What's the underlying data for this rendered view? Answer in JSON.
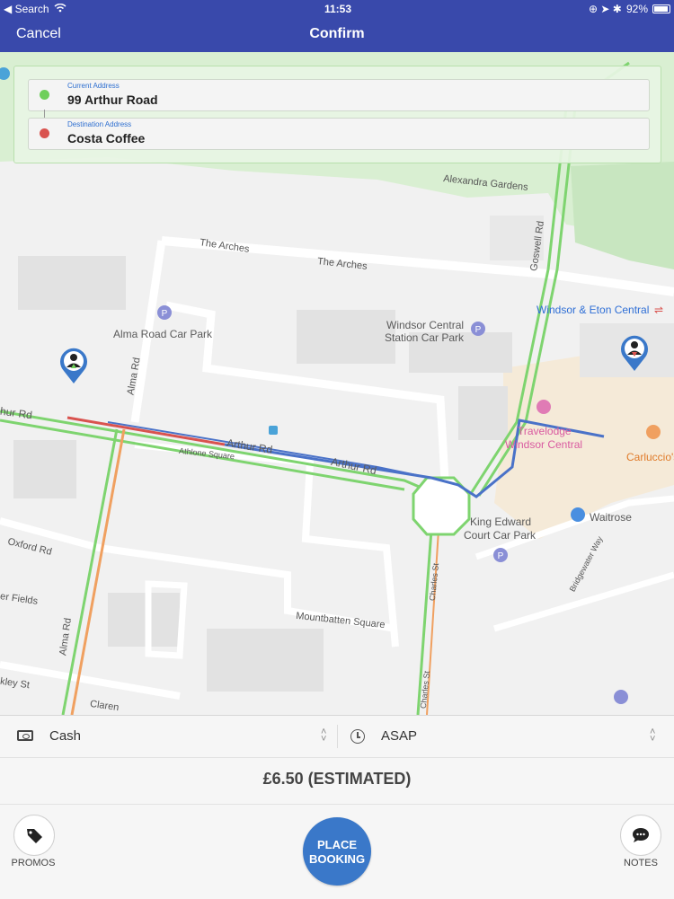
{
  "status_bar": {
    "back_label": "Search",
    "time": "11:53",
    "battery": "92%"
  },
  "nav": {
    "cancel_label": "Cancel",
    "title": "Confirm"
  },
  "addresses": {
    "current_label": "Current Address",
    "current_value": "99 Arthur Road",
    "destination_label": "Destination Address",
    "destination_value": "Costa Coffee"
  },
  "map": {
    "labels": {
      "alexandra_gardens": "Alexandra Gardens",
      "the_arches_1": "The Arches",
      "the_arches_2": "The Arches",
      "goswell_rd": "Goswell Rd",
      "windsor_eton": "Windsor & Eton Central",
      "alma_road_car_park": "Alma Road Car Park",
      "alma_rd_1": "Alma Rd",
      "alma_rd_2": "Alma Rd",
      "windsor_central_car_park_1": "Windsor Central",
      "windsor_central_car_park_2": "Station Car Park",
      "arthur_rd_left": "hur Rd",
      "arthur_rd_1": "Arthur Rd",
      "arthur_rd_2": "Arthur Rd",
      "athlone_square": "Athlone Square",
      "travelodge_1": "Travelodge",
      "travelodge_2": "Windsor Central",
      "carluccio": "Carluccio's",
      "king_edward_1": "King Edward",
      "king_edward_2": "Court Car Park",
      "waitrose": "Waitrose",
      "oxford_rd": "Oxford Rd",
      "fields": "er Fields",
      "charles_st_1": "Charles St",
      "charles_st_2": "Charles St",
      "bridgewater_way": "Bridgewater Way",
      "mountbatten_square": "Mountbatten Square",
      "kley_st": "kley St",
      "claren": "Claren"
    }
  },
  "booking": {
    "payment_label": "Cash",
    "time_label": "ASAP",
    "price_label": "£6.50 (ESTIMATED)",
    "promos_label": "PROMOS",
    "place_label_1": "PLACE",
    "place_label_2": "BOOKING",
    "notes_label": "NOTES"
  },
  "colors": {
    "brand": "#3949ab",
    "route": "#4a72c8",
    "start_dot": "#6fcf5b",
    "end_dot": "#d9534f",
    "button": "#3a78c9"
  }
}
